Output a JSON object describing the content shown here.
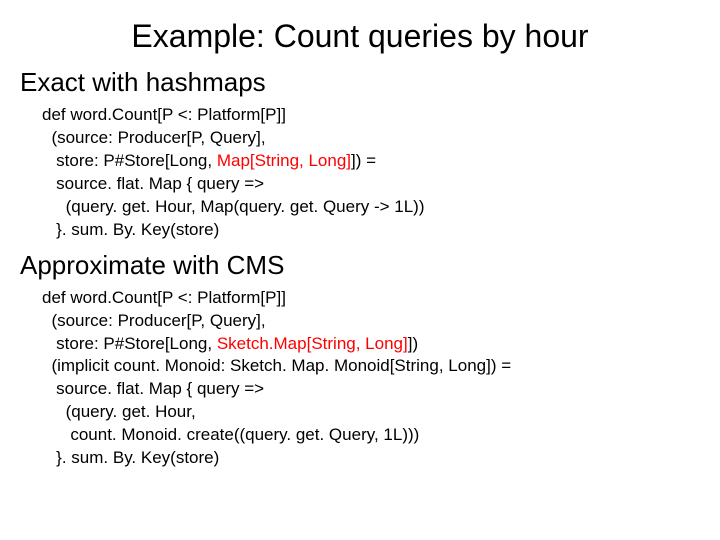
{
  "title": "Example: Count queries by hour",
  "section1": {
    "heading": "Exact with hashmaps",
    "code": {
      "l1": "def word.Count[P <: Platform[P]]",
      "l2": "  (source: Producer[P, Query],",
      "l3_a": "   store: P#Store[Long, ",
      "l3_red": "Map[String, Long]",
      "l3_b": "]) =",
      "l4": "   source. flat. Map { query =>",
      "l5": "     (query. get. Hour, Map(query. get. Query -> 1L))",
      "l6": "   }. sum. By. Key(store)"
    }
  },
  "section2": {
    "heading": "Approximate with CMS",
    "code": {
      "l1": "def word.Count[P <: Platform[P]]",
      "l2": "  (source: Producer[P, Query],",
      "l3_a": "   store: P#Store[Long, ",
      "l3_red": "Sketch.Map[String, Long]",
      "l3_b": "])",
      "l4": "  (implicit count. Monoid: Sketch. Map. Monoid[String, Long]) =",
      "l5": "   source. flat. Map { query =>",
      "l6": "     (query. get. Hour,",
      "l7": "      count. Monoid. create((query. get. Query, 1L)))",
      "l8": "   }. sum. By. Key(store)"
    }
  }
}
